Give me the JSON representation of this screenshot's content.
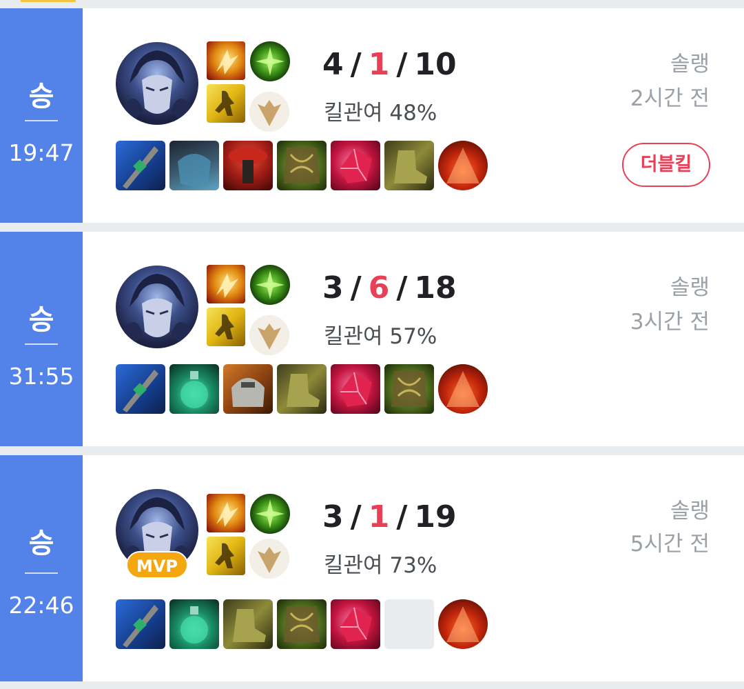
{
  "matches": [
    {
      "result": "승",
      "duration": "19:47",
      "kills": "4",
      "deaths": "1",
      "assists": "10",
      "kill_participation": "킬관여 48%",
      "queue": "솔랭",
      "time_ago": "2시간 전",
      "badge": "더블킬",
      "items": [
        "dagger",
        "chain",
        "mushroom",
        "bramble",
        "gem",
        "boots",
        "ward"
      ]
    },
    {
      "result": "승",
      "duration": "31:55",
      "kills": "3",
      "deaths": "6",
      "assists": "18",
      "kill_participation": "킬관여 57%",
      "queue": "솔랭",
      "time_ago": "3시간 전",
      "items": [
        "dagger",
        "potion",
        "helm",
        "boots",
        "gem",
        "bramble",
        "ward"
      ]
    },
    {
      "result": "승",
      "duration": "22:46",
      "kills": "3",
      "deaths": "1",
      "assists": "19",
      "kill_participation": "킬관여 73%",
      "queue": "솔랭",
      "time_ago": "5시간 전",
      "mvp": "MVP",
      "items": [
        "dagger",
        "potion",
        "boots",
        "bramble",
        "gem",
        "empty",
        "ward"
      ]
    }
  ],
  "score_separator": "/",
  "icons": {
    "champion": "champion-portrait-icon",
    "spell_1": "flash-spell-icon",
    "spell_2": "ghost-spell-icon",
    "rune_1": "precision-keystone-rune-icon",
    "rune_2": "secondary-rune-tree-icon"
  },
  "colors": {
    "win": "#5383e8",
    "deaths": "#e84057",
    "mvp": "#f4a70e",
    "badge": "#e84057"
  }
}
